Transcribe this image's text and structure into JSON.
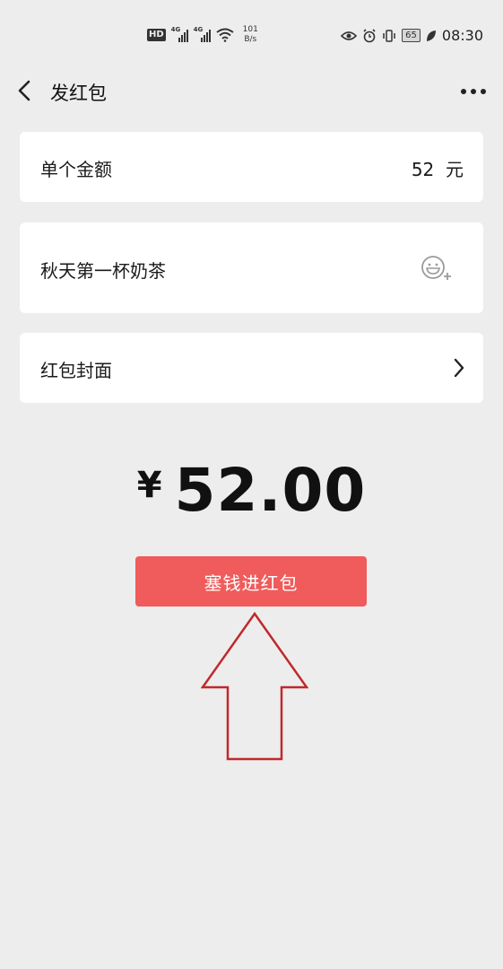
{
  "status_bar": {
    "hd": "HD",
    "net_1": "4G",
    "net_2": "4G",
    "speed_value": "101",
    "speed_unit": "B/s",
    "battery": "65",
    "time": "08:30"
  },
  "nav": {
    "title": "发红包"
  },
  "amount_card": {
    "label": "单个金额",
    "value": "52",
    "unit": "元"
  },
  "note_card": {
    "text": "秋天第一杯奶茶"
  },
  "cover_card": {
    "label": "红包封面"
  },
  "total": {
    "currency": "¥",
    "amount": "52.00"
  },
  "send_button": {
    "label": "塞钱进红包"
  },
  "colors": {
    "background": "#ededed",
    "button": "#f05b5b",
    "annotation_arrow": "#c0282d"
  }
}
